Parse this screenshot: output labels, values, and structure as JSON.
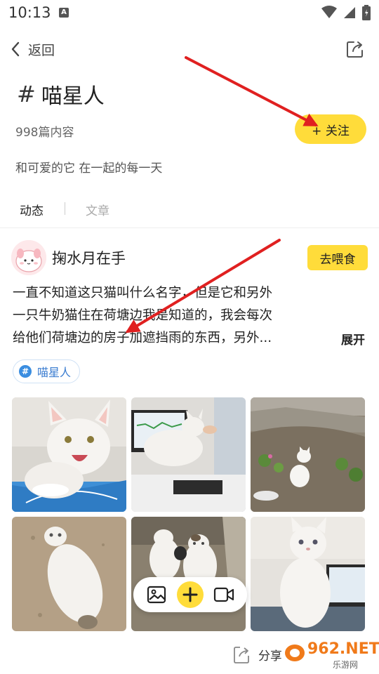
{
  "status": {
    "time": "10:13",
    "notif_badge": "A",
    "icons": [
      "wifi-icon",
      "signal-icon",
      "battery-icon"
    ]
  },
  "nav": {
    "back_label": "返回",
    "share_icon": "share-icon"
  },
  "topic": {
    "hash": "#",
    "title": "喵星人",
    "count": "998篇内容",
    "follow_label": "+ 关注",
    "description": "和可爱的它 在一起的每一天"
  },
  "tabs": {
    "active": "动态",
    "inactive": "文章"
  },
  "post": {
    "username": "掬水月在手",
    "feed_label": "去喂食",
    "lines": [
      "一直不知道这只猫叫什么名字，但是它和另外",
      "一只牛奶猫住在荷塘边我是知道的，我会每次",
      "给他们荷塘边的房子加遮挡雨的东西，另外..."
    ],
    "expand_label": "展开",
    "tag_label": "喵星人",
    "tag_icon": "hash-icon",
    "images": [
      "cat-photo",
      "cat-photo",
      "cat-photo",
      "cat-photo",
      "cat-photo",
      "cat-photo"
    ]
  },
  "float_bar": {
    "icons": [
      "image-icon",
      "plus-icon",
      "video-icon"
    ]
  },
  "bottom": {
    "share_label": "分享"
  },
  "watermark": {
    "text": "962.NET",
    "sub": "乐游网"
  },
  "colors": {
    "accent_yellow": "#ffdc3a",
    "tag_blue": "#3a8de0",
    "annotation_red": "#e02020"
  }
}
